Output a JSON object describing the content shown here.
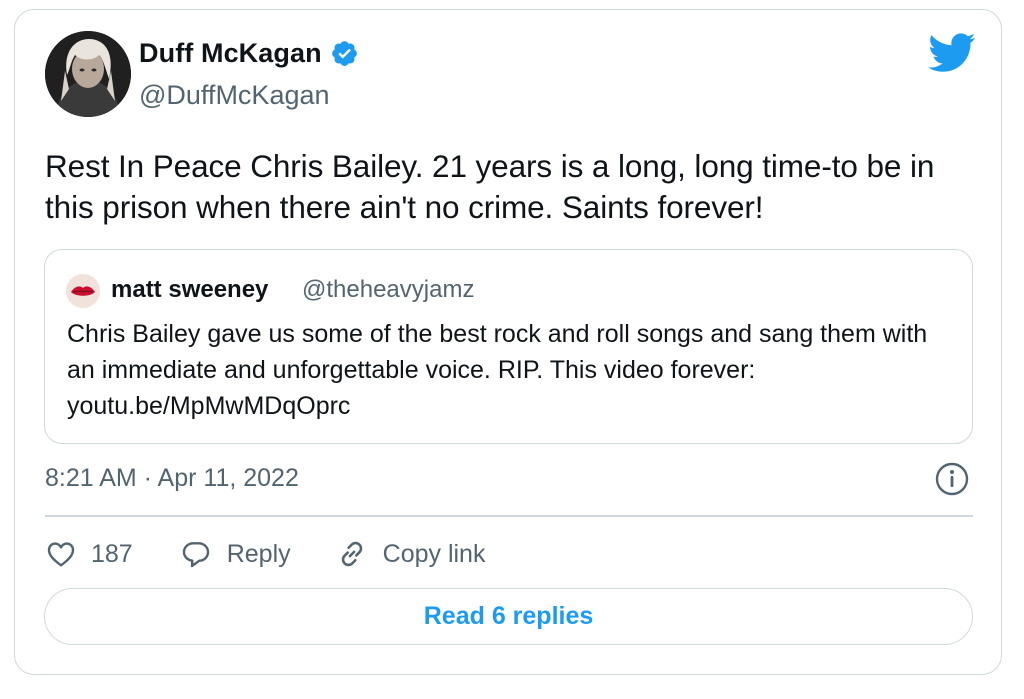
{
  "tweet": {
    "author": {
      "display_name": "Duff McKagan",
      "handle": "@DuffMcKagan",
      "verified": true
    },
    "text": "Rest In Peace Chris Bailey. 21 years is a long, long time-to be in this prison when there ain't no crime. Saints forever!",
    "timestamp": "8:21 AM · Apr 11, 2022"
  },
  "quoted_tweet": {
    "display_name": "matt sweeney",
    "handle": "@theheavyjamz",
    "text": "Chris Bailey gave us some of the best rock and roll songs and sang them with an immediate and unforgettable voice. RIP. This video forever: youtu.be/MpMwMDqOprc"
  },
  "actions": {
    "like_count": "187",
    "reply_label": "Reply",
    "copy_link_label": "Copy link"
  },
  "read_replies_label": "Read 6 replies",
  "icons": {
    "brand": "twitter-bird-icon",
    "verified": "verified-badge-icon",
    "info": "info-icon",
    "like": "heart-icon",
    "reply": "speech-bubble-icon",
    "copy_link": "link-icon"
  },
  "colors": {
    "accent": "#1d9bf0",
    "text": "#0f1419",
    "secondary": "#536471",
    "border": "#cfd9de"
  }
}
